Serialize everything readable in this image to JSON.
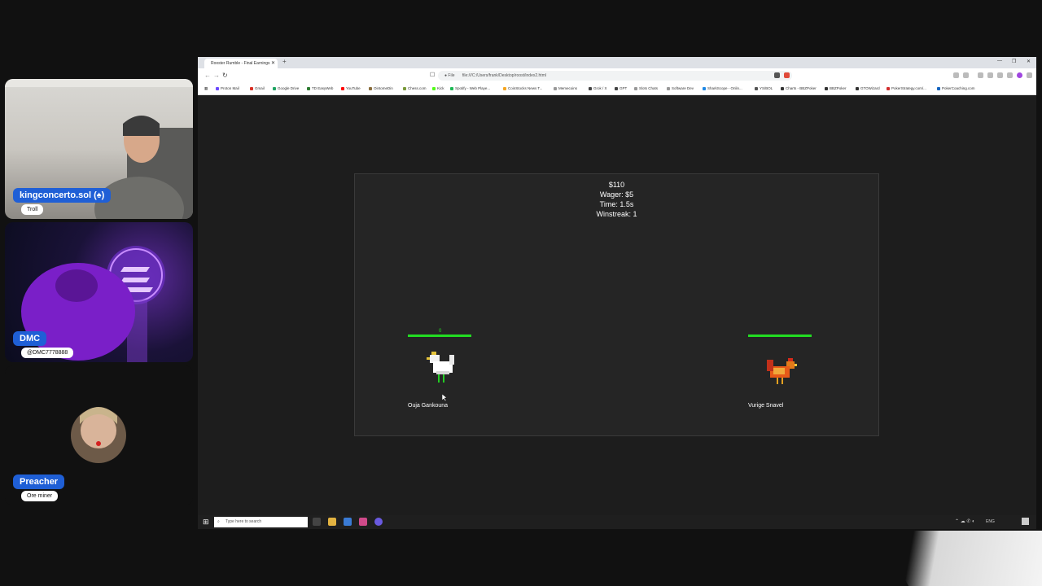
{
  "participants": [
    {
      "name": "kingconcerto.sol (♠)",
      "role": "Troll"
    },
    {
      "name": "DMC",
      "role": "@DMC7778888"
    },
    {
      "name": "Preacher",
      "role": "Ore miner"
    }
  ],
  "browser": {
    "tab_title": "Rooster Rumble - Final Earnings",
    "url_scheme": "File",
    "url": "file:///C:/Users/frank/Desktop/roost/index2.html",
    "bookmarks": [
      "Proton Mail",
      "Gmail",
      "Google Drive",
      "TD EasyWeb",
      "YouTube",
      "OintomeDin",
      "Chess.com",
      "Kick",
      "Spotify - Web Playe...",
      "CoinStocks News T...",
      "Memecoins",
      "Grok / X",
      "GPT",
      "Slots Chats",
      "Software Dev",
      "SharkScope - Onlin...",
      "YS/BOL",
      "Charts - BBZPoker",
      "BBZPoker",
      "GTOWizard",
      "PokerStrategy.com/...",
      "PokerCoaching.com"
    ]
  },
  "game": {
    "balance": "$110",
    "wager": "Wager: $5",
    "time": "Time: 1.5s",
    "winstreak": "Winstreak: 1",
    "player": {
      "name": "Ouja Gankouna",
      "hp_indicator": "0",
      "health_pct": 100
    },
    "opponent": {
      "name": "Vurige Snavel",
      "health_pct": 100
    }
  },
  "taskbar": {
    "search_placeholder": "Type here to search",
    "language": "ENG"
  },
  "colors": {
    "health_bar": "#22dd22",
    "name_tag": "#1f5fd6"
  }
}
